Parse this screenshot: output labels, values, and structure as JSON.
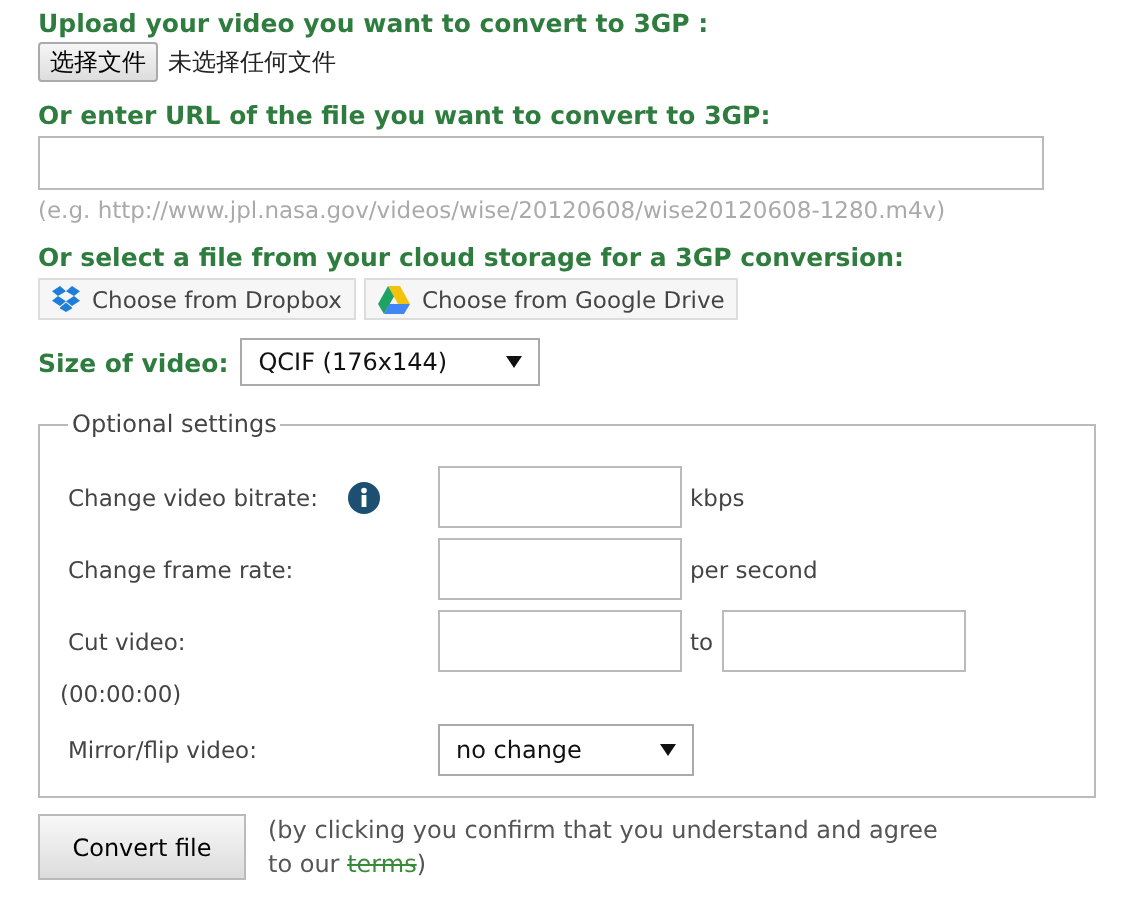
{
  "upload": {
    "heading": "Upload your video you want to convert to 3GP :",
    "button": "选择文件",
    "status": "未选择任何文件"
  },
  "url": {
    "heading": "Or enter URL of the file you want to convert to 3GP:",
    "hint": "(e.g. http://www.jpl.nasa.gov/videos/wise/20120608/wise20120608-1280.m4v)"
  },
  "cloud": {
    "heading": "Or select a file from your cloud storage for a 3GP conversion:",
    "buttons": [
      {
        "kind": "dropbox",
        "label": "Choose from Dropbox"
      },
      {
        "kind": "drive",
        "label": "Choose from Google Drive"
      }
    ]
  },
  "size": {
    "label": "Size of video:",
    "value": "QCIF (176x144)"
  },
  "optional": {
    "legend": "Optional settings",
    "rows": [
      {
        "kind": "input",
        "label": "Change video bitrate:",
        "info": true,
        "unit": "kbps"
      },
      {
        "kind": "input",
        "label": "Change frame rate:",
        "info": false,
        "unit": "per second"
      },
      {
        "kind": "range",
        "label": "Cut video:",
        "between": "to",
        "note": "(00:00:00)"
      },
      {
        "kind": "select",
        "label": "Mirror/flip video:",
        "value": "no change"
      }
    ]
  },
  "submit": {
    "button": "Convert file",
    "text_before": "(by clicking you confirm that you understand and agree to our ",
    "link": "terms",
    "text_after": ")"
  }
}
